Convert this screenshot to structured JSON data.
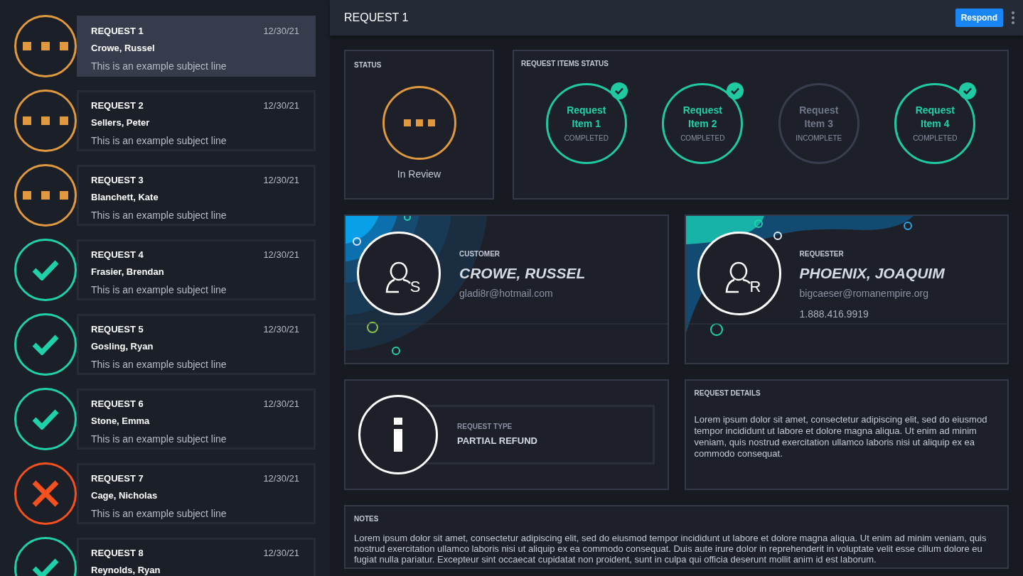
{
  "sidebar": {
    "requests": [
      {
        "title": "REQUEST 1",
        "date": "12/30/21",
        "name": "Crowe, Russel",
        "subject": "This is an example subject line",
        "kind": "review",
        "selected": true
      },
      {
        "title": "REQUEST 2",
        "date": "12/30/21",
        "name": "Sellers, Peter",
        "subject": "This is an example subject line",
        "kind": "review",
        "selected": false
      },
      {
        "title": "REQUEST 3",
        "date": "12/30/21",
        "name": "Blanchett, Kate",
        "subject": "This is an example subject line",
        "kind": "review",
        "selected": false
      },
      {
        "title": "REQUEST 4",
        "date": "12/30/21",
        "name": "Frasier, Brendan",
        "subject": "This is an example subject line",
        "kind": "done",
        "selected": false
      },
      {
        "title": "REQUEST 5",
        "date": "12/30/21",
        "name": "Gosling, Ryan",
        "subject": "This is an example subject line",
        "kind": "done",
        "selected": false
      },
      {
        "title": "REQUEST 6",
        "date": "12/30/21",
        "name": "Stone, Emma",
        "subject": "This is an example subject line",
        "kind": "done",
        "selected": false
      },
      {
        "title": "REQUEST 7",
        "date": "12/30/21",
        "name": "Cage, Nicholas",
        "subject": "This is an example subject line",
        "kind": "rejected",
        "selected": false
      },
      {
        "title": "REQUEST 8",
        "date": "12/30/21",
        "name": "Reynolds, Ryan",
        "kind": "done",
        "selected": false
      }
    ]
  },
  "header": {
    "title": "REQUEST 1",
    "button": "Respond"
  },
  "status": {
    "label": "STATUS",
    "kind": "review",
    "text": "In Review"
  },
  "items_status": {
    "label": "REQUEST ITEMS STATUS",
    "items": [
      {
        "name": "Request Item 1",
        "state": "COMPLETED",
        "completed": true
      },
      {
        "name": "Request Item 2",
        "state": "COMPLETED",
        "completed": true
      },
      {
        "name": "Request Item 3",
        "state": "INCOMPLETE",
        "completed": false
      },
      {
        "name": "Request Item 4",
        "state": "COMPLETED",
        "completed": true
      }
    ]
  },
  "customer": {
    "label": "CUSTOMER",
    "name": "CROWE, RUSSEL",
    "email": "gladi8r@hotmail.com",
    "badge": "S"
  },
  "requester": {
    "label": "REQUESTER",
    "name": "PHOENIX, JOAQUIM",
    "email": "bigcaeser@romanempire.org",
    "phone": "1.888.416.9919",
    "badge": "R"
  },
  "request_type": {
    "label": "REQUEST TYPE",
    "value": "PARTIAL REFUND"
  },
  "request_details": {
    "label": "REQUEST DETAILS",
    "text": "Lorem ipsum dolor sit amet, consectetur adipiscing elit, sed do eiusmod tempor incididunt ut labore et dolore magna aliqua. Ut enim ad minim veniam, quis nostrud exercitation ullamco laboris nisi ut aliquip ex ea commodo consequat."
  },
  "notes": {
    "label": "NOTES",
    "text": "Lorem ipsum dolor sit amet, consectetur adipiscing elit, sed do eiusmod tempor incididunt ut labore et dolore magna aliqua. Ut enim ad minim veniam, quis nostrud exercitation ullamco laboris nisi ut aliquip ex ea commodo consequat. Duis aute irure dolor in reprehenderit in voluptate velit esse cillum dolore eu fugiat nulla pariatur. Excepteur sint occaecat cupidatat non proident, sunt in culpa qui officia deserunt mollit anim id est laborum."
  }
}
